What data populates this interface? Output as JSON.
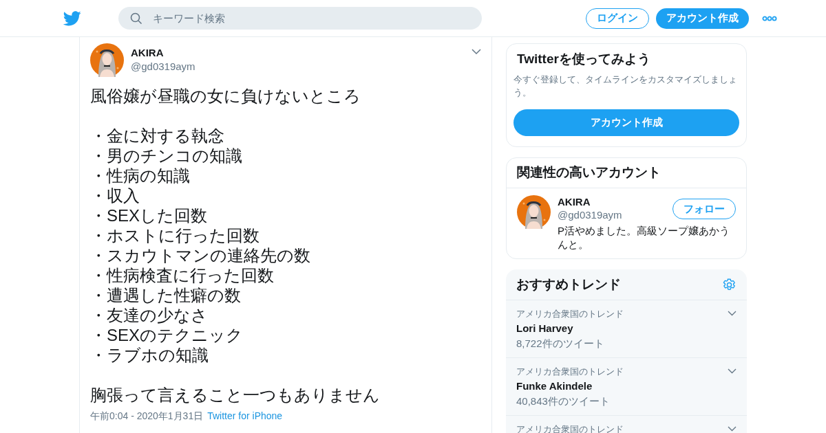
{
  "header": {
    "search": {
      "placeholder": "キーワード検索"
    },
    "login": "ログイン",
    "signup": "アカウント作成"
  },
  "tweet": {
    "name": "AKIRA",
    "handle": "@gd0319aym",
    "paragraphs": [
      {
        "lines": [
          "風俗嬢が昼職の女に負けないところ"
        ]
      },
      {
        "lines": [
          "・金に対する執念",
          "・男のチンコの知識",
          "・性病の知識",
          "・収入",
          "・SEXした回数",
          "・ホストに行った回数",
          "・スカウトマンの連絡先の数",
          "・性病検査に行った回数",
          "・遭遇した性癖の数",
          "・友達の少なさ",
          "・SEXのテクニック",
          "・ラブホの知識"
        ]
      },
      {
        "lines": [
          "胸張って言えること一つもありません"
        ]
      }
    ],
    "time": "午前0:04 - 2020年1月31日",
    "source": "Twitter for iPhone"
  },
  "signup_card": {
    "title": "Twitterを使ってみよう",
    "text": "今すぐ登録して、タイムラインをカスタマイズしましょう。",
    "button": "アカウント作成"
  },
  "related": {
    "title": "関連性の高いアカウント",
    "accounts": [
      {
        "name": "AKIRA",
        "handle": "@gd0319aym",
        "bio": "P活やめました。高級ソープ嬢あかうんと。",
        "follow": "フォロー"
      }
    ]
  },
  "trends": {
    "title": "おすすめトレンド",
    "items": [
      {
        "context": "アメリカ合衆国のトレンド",
        "name": "Lori Harvey",
        "count": "8,722件のツイート"
      },
      {
        "context": "アメリカ合衆国のトレンド",
        "name": "Funke Akindele",
        "count": "40,843件のツイート"
      },
      {
        "context": "アメリカ合衆国のトレンド"
      }
    ]
  }
}
